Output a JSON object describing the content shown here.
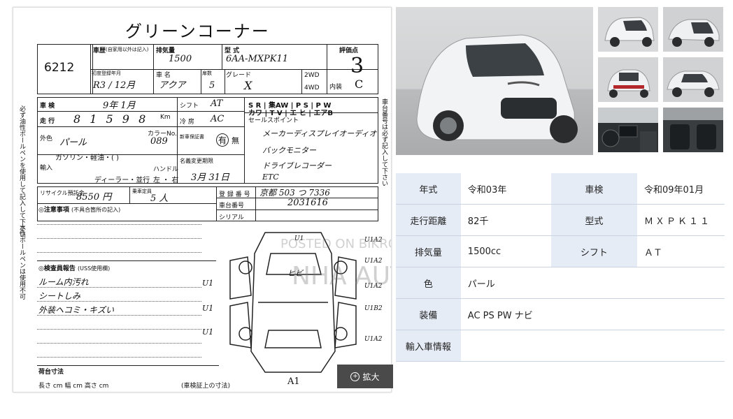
{
  "sheet": {
    "title": "グリーンコーナー",
    "lot_number": "6212",
    "label_model_history": "車歴",
    "label_note_history": "(自家用以外は記入)",
    "label_displacement": "排気量",
    "displacement_hand": "1500",
    "label_type": "型 式",
    "type_hand": "6AA-MXPK11",
    "label_score": "評価点",
    "score_hand": "3",
    "label_first_reg": "初度登録年月",
    "first_reg_hand": "R3 / 12月",
    "label_car_name": "車 名",
    "car_name_hand": "アクア",
    "label_doors": "扉数",
    "doors_hand": "5",
    "label_grade": "グレード",
    "grade_hand": "X",
    "label_2wd": "2WD",
    "label_4wd": "4WD",
    "label_interior": "内装",
    "interior_hand": "C",
    "label_inspection": "車 検",
    "inspection_hand": "9年  1月",
    "label_shift": "シフト",
    "shift_hand": "AT",
    "label_mileage": "走 行",
    "mileage_hand": "8 1 5 9 8",
    "label_km": "Km",
    "label_aircon": "冷 房",
    "aircon_hand": "AC",
    "label_color": "外色",
    "color_hand": "パール",
    "label_color_no": "カラーNo.",
    "color_no_hand": "089",
    "label_manual": "新車保証書",
    "manual_yes": "有",
    "manual_no": "無",
    "label_fuel": "ガソリン・軽油・(    )",
    "label_import": "輸入",
    "label_dealer": "ディーラー・並行",
    "label_handle": "ハンドル",
    "label_lr": "左 ・ 右",
    "label_expire": "名義変更期限",
    "expire_hand": "3月 31日",
    "label_recycle": "リサイクル預託金",
    "recycle_hand": "8550 円",
    "label_capacity": "乗車定員",
    "capacity_hand": "5 人",
    "label_reg_no": "登 録 番 号",
    "reg_no_hand": "京都  503  つ  7336",
    "label_chassis": "車台番号",
    "chassis_hand": "2031616",
    "label_serial": "シリアル",
    "label_sales_points": "セールスポイント",
    "sales_points": [
      "メーカーディスプレイオーディオ",
      "バックモニター",
      "ドライブレコーダー",
      "ETC"
    ],
    "equip_row1": "S R  | 集AW  | P S  | P W",
    "equip_row2": "カワ  | T V  | エ ヒ  | エアB",
    "label_notice": "注意事項",
    "label_notice_sub": "(不具合箇所の記入)",
    "label_inspector": "検査員報告",
    "label_inspector_sub": "(USS使用欄)",
    "inspector_notes": [
      "ルーム内汚れ",
      "シートしみ",
      "外装ヘコミ・キズい"
    ],
    "label_dims": "長さ       cm  幅       cm  高さ       cm",
    "label_dims_note": "車検証上の寸法",
    "label_cargo": "荷台寸法",
    "diagram_marks": [
      "U1A2",
      "U1A2",
      "U1A2",
      "U1B2",
      "U1A2",
      "U1",
      "U1",
      "U1",
      "ヒビ",
      "U1"
    ],
    "bottom_hand": "A1",
    "side_vertical_left": "必ず油性ボールペンを使用して記入して下さい",
    "side_vertical_right": "車台番号は必ず記入して下さい",
    "side_vertical_left2": "水性ボールペンは使用不可"
  },
  "expand_button": {
    "icon": "zoom-in-icon",
    "label": "拡大"
  },
  "watermark": {
    "line1": "POSTED ON BIKROY",
    "line2": "NHA AUTO"
  },
  "spec_table": [
    {
      "k1": "年式",
      "v1": "令和03年",
      "k2": "車検",
      "v2": "令和09年01月"
    },
    {
      "k1": "走行距離",
      "v1": "82千",
      "k2": "型式",
      "v2": "ＭＸＰＫ１１"
    },
    {
      "k1": "排気量",
      "v1": "1500cc",
      "k2": "シフト",
      "v2": "ＡＴ"
    },
    {
      "k1": "色",
      "v1": "パール",
      "k2": "",
      "v2": ""
    },
    {
      "k1": "装備",
      "v1": "AC PS PW ナビ",
      "k2": "",
      "v2": ""
    },
    {
      "k1": "輸入車情報",
      "v1": "",
      "k2": "",
      "v2": ""
    }
  ],
  "colors": {
    "table_key_bg": "#e6ecf6",
    "table_border": "#c9d3e4",
    "button_bg": "#4a4a4a"
  }
}
